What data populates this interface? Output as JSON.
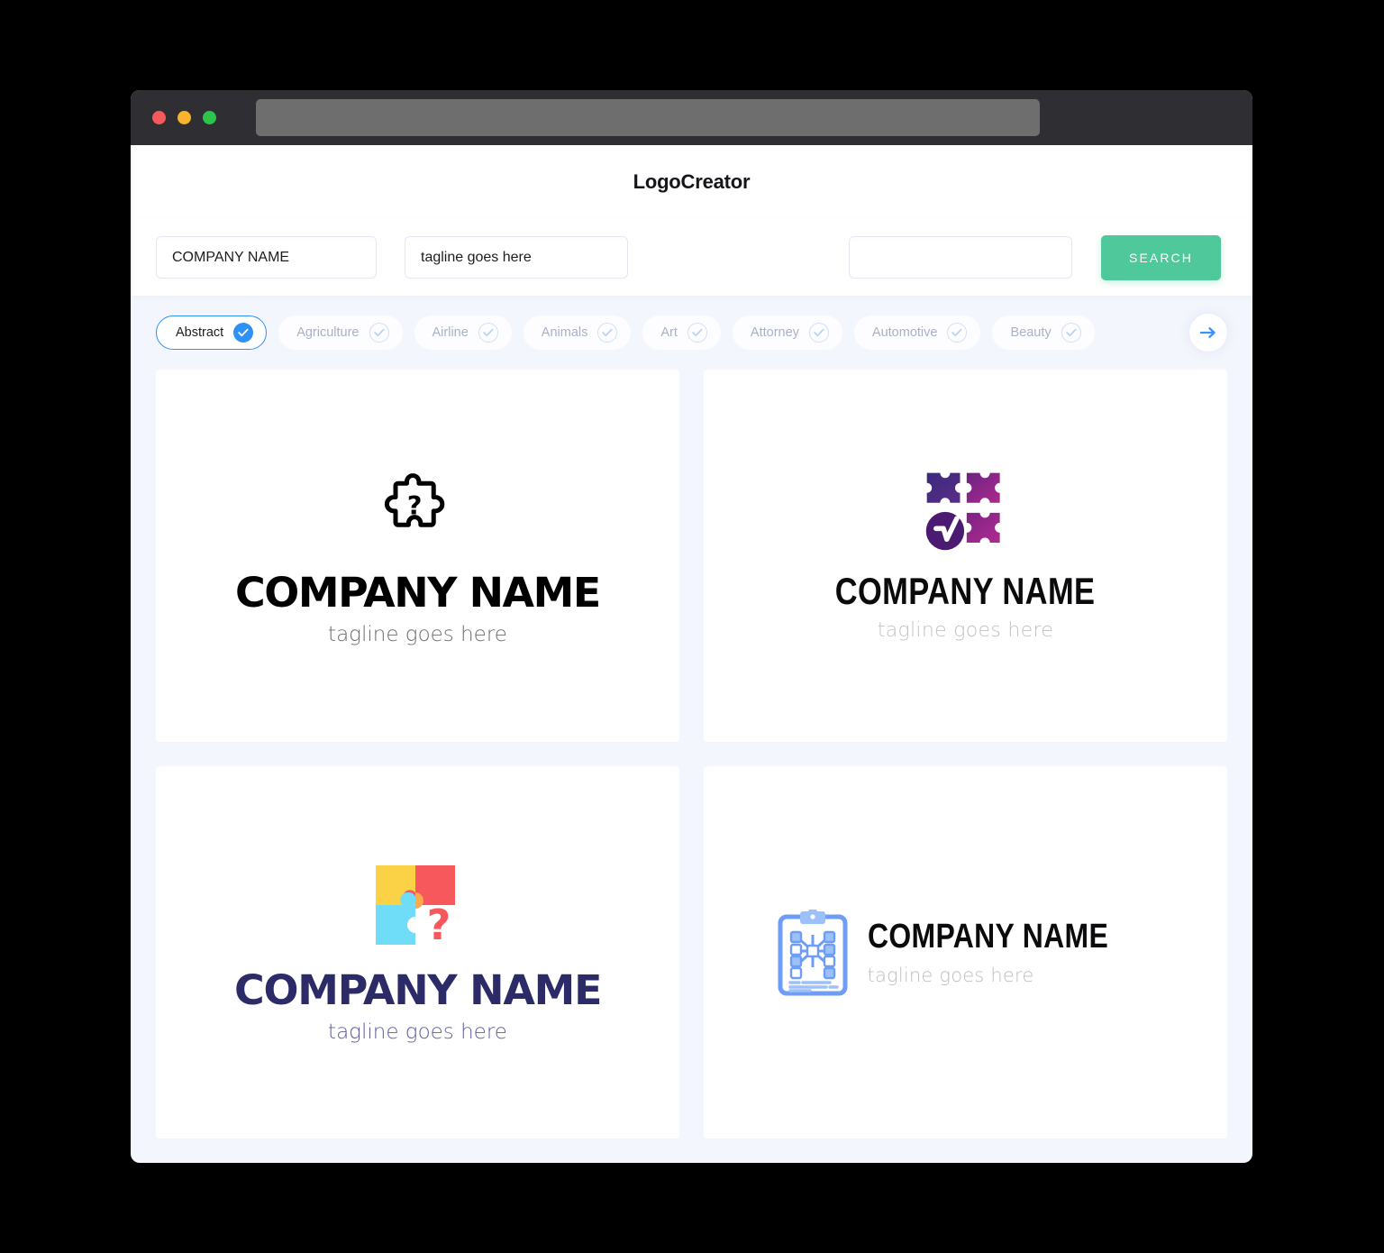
{
  "window": {
    "traffic_lights": [
      "close",
      "minimize",
      "maximize"
    ],
    "url_value": ""
  },
  "header": {
    "title": "LogoCreator"
  },
  "search": {
    "company_value": "COMPANY NAME",
    "company_placeholder": "COMPANY NAME",
    "tagline_value": "tagline goes here",
    "tagline_placeholder": "tagline goes here",
    "extra_value": "",
    "extra_placeholder": "",
    "button_label": "SEARCH"
  },
  "categories": {
    "next_label": "next-categories",
    "items": [
      {
        "label": "Abstract",
        "selected": true
      },
      {
        "label": "Agriculture",
        "selected": false
      },
      {
        "label": "Airline",
        "selected": false
      },
      {
        "label": "Animals",
        "selected": false
      },
      {
        "label": "Art",
        "selected": false
      },
      {
        "label": "Attorney",
        "selected": false
      },
      {
        "label": "Automotive",
        "selected": false
      },
      {
        "label": "Beauty",
        "selected": false
      }
    ]
  },
  "results": {
    "cards": [
      {
        "icon": "puzzle-question-outline-icon",
        "name": "COMPANY NAME",
        "tagline": "tagline goes here",
        "layout": "stacked",
        "name_color": "#000000",
        "tagline_color": "#6E6E73"
      },
      {
        "icon": "puzzle-grid-check-icon",
        "name": "COMPANY NAME",
        "tagline": "tagline goes here",
        "layout": "stacked",
        "name_color": "#0B0B0D",
        "tagline_color": "#C2C2C6"
      },
      {
        "icon": "puzzle-colored-question-icon",
        "name": "COMPANY NAME",
        "tagline": "tagline goes here",
        "layout": "stacked",
        "name_color": "#2C2B68",
        "tagline_color": "#5E5E9E"
      },
      {
        "icon": "clipboard-network-icon",
        "name": "COMPANY NAME",
        "tagline": "tagline goes here",
        "layout": "horizontal",
        "name_color": "#0B0B0D",
        "tagline_color": "#BFBFC4"
      }
    ]
  },
  "colors": {
    "accent_blue": "#2F90F5",
    "accent_green": "#4FC99C",
    "page_bg": "#F4F6FD",
    "titlebar_bg": "#2F2F33",
    "dot_red": "#F6595C",
    "dot_yellow": "#F9B42D",
    "dot_green": "#2DC44C"
  }
}
